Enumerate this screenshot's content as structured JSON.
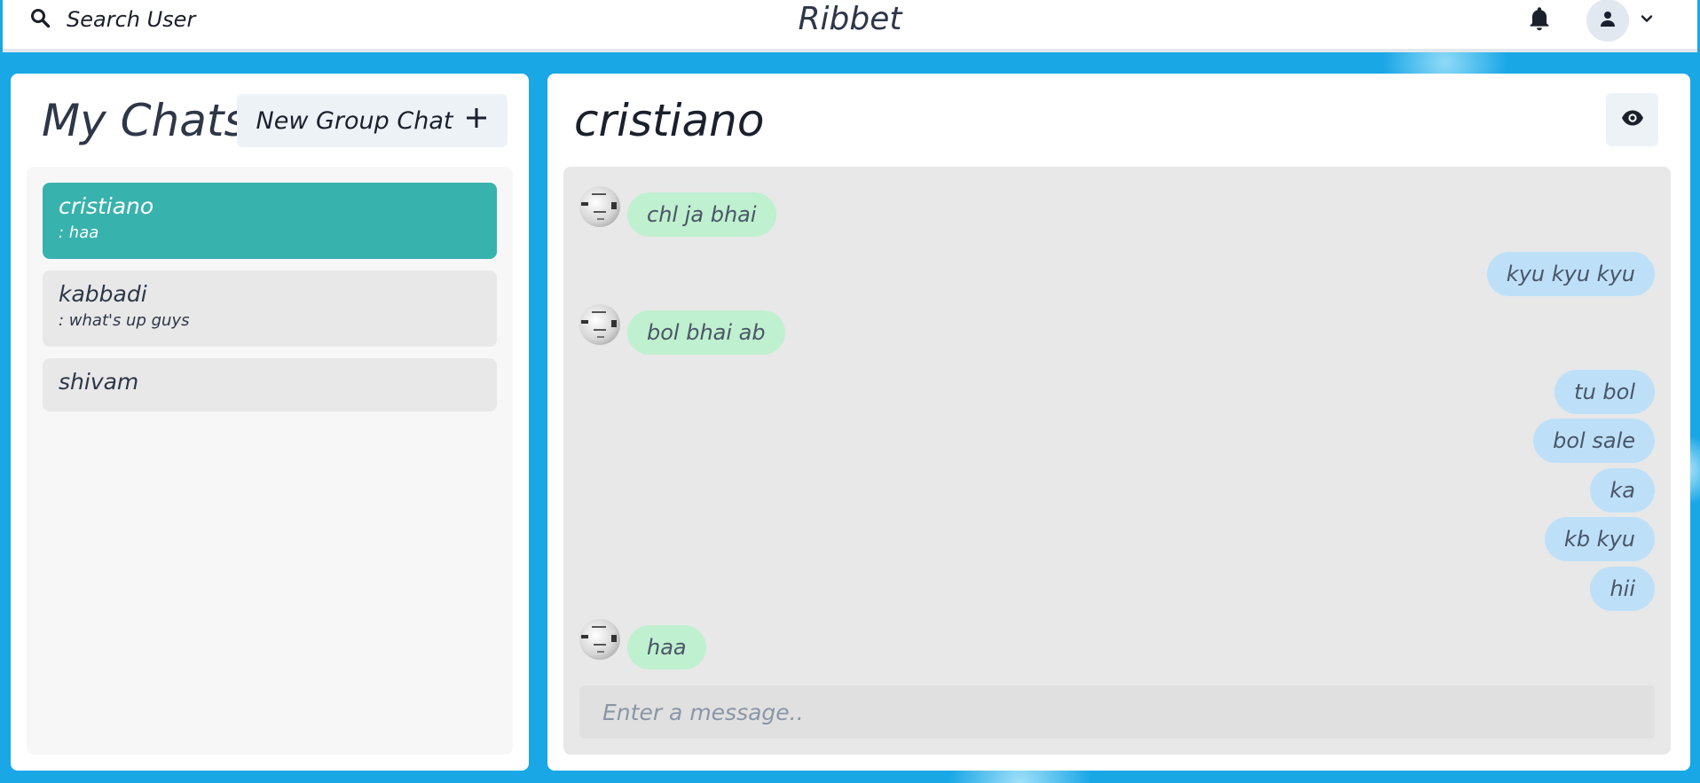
{
  "header": {
    "search_label": "Search User",
    "brand": "Ribbet"
  },
  "sidebar": {
    "title": "My Chats",
    "new_group_label": "New Group Chat",
    "chats": [
      {
        "name": "cristiano",
        "last_message": ": haa",
        "active": true
      },
      {
        "name": "kabbadi",
        "last_message": ": what's up guys",
        "active": false
      },
      {
        "name": "shivam",
        "last_message": "",
        "active": false
      }
    ]
  },
  "conversation": {
    "title": "cristiano",
    "messages": [
      {
        "text": "chl ja bhai",
        "direction": "in"
      },
      {
        "text": "kyu kyu kyu",
        "direction": "out"
      },
      {
        "text": "bol bhai ab",
        "direction": "in"
      },
      {
        "text": "tu bol",
        "direction": "out"
      },
      {
        "text": "bol sale",
        "direction": "out"
      },
      {
        "text": "ka",
        "direction": "out"
      },
      {
        "text": "kb kyu",
        "direction": "out"
      },
      {
        "text": "hii",
        "direction": "out"
      },
      {
        "text": "haa",
        "direction": "in"
      }
    ],
    "input_placeholder": "Enter a message.."
  },
  "colors": {
    "active_chat": "#38b2ac",
    "incoming_bubble": "#bff0cf",
    "outgoing_bubble": "#bde0f8",
    "background": "#1aa7e6"
  }
}
